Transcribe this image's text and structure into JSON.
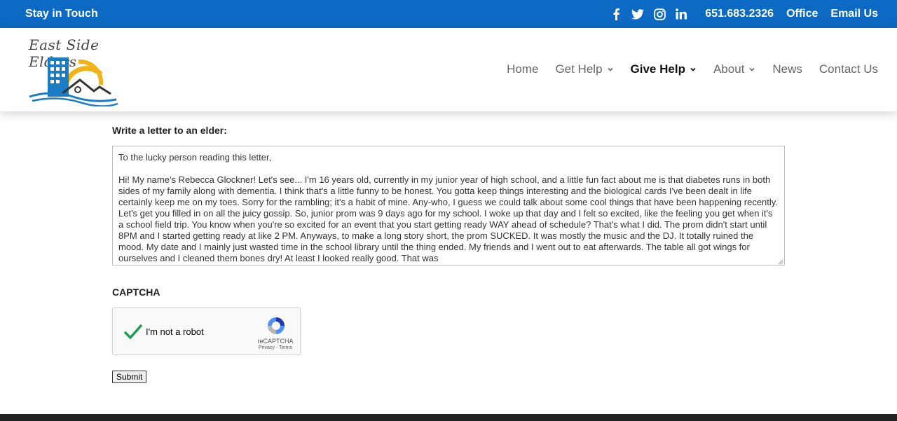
{
  "topbar": {
    "tagline": "Stay in Touch",
    "social_icons": [
      "facebook-icon",
      "twitter-icon",
      "instagram-icon",
      "linkedin-icon"
    ],
    "phone": "651.683.2326",
    "office": "Office",
    "email": "Email Us",
    "background": "#0c6ac4"
  },
  "header": {
    "logo_text": "East Side Elders",
    "nav": [
      {
        "label": "Home",
        "has_dropdown": false
      },
      {
        "label": "Get Help",
        "has_dropdown": true
      },
      {
        "label": "Give Help",
        "has_dropdown": true,
        "active": true
      },
      {
        "label": "About",
        "has_dropdown": true
      },
      {
        "label": "News",
        "has_dropdown": false
      },
      {
        "label": "Contact Us",
        "has_dropdown": false
      }
    ]
  },
  "form": {
    "letter_label": "Write a letter to an elder:",
    "letter_value": "To the lucky person reading this letter,\n\nHi! My name's Rebecca Glockner! Let's see... I'm 16 years old, currently in my junior year of high school, and a little fun fact about me is that diabetes runs in both sides of my family along with dementia. I think that's a little funny to be honest. You gotta keep things interesting and the biological cards I've been dealt in life certainly keep me on my toes. Sorry for the rambling; it's a habit of mine. Any-who, I guess we could talk about some cool things that have been happening recently. Let's get you filled in on all the juicy gossip. So, junior prom was 9 days ago for my school. I woke up that day and I felt so excited, like the feeling you get when it's a school field trip. You know when you're so excited for an event that you start getting ready WAY ahead of schedule? That's what I did. The prom didn't start until 8PM and I started getting ready at like 2 PM. Anyways, to make a long story short, the prom SUCKED. It was mostly the music and the DJ. It totally ruined the mood. My date and I mainly just wasted time in the school library until the thing ended. My friends and I went out to eat afterwards. The table all got wings for ourselves and I cleaned them bones dry! At least I looked really good. That was",
    "captcha_label": "CAPTCHA",
    "recaptcha": {
      "text": "I'm not a robot",
      "brand": "reCAPTCHA",
      "terms": "Privacy - Terms",
      "checked": true,
      "check_color": "#1e9e52"
    },
    "submit_label": "Submit"
  }
}
